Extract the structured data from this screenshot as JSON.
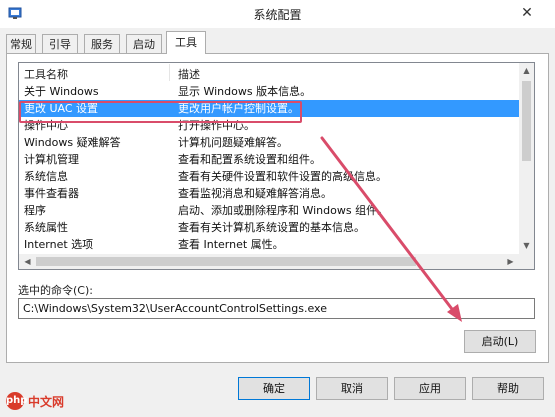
{
  "window": {
    "title": "系统配置",
    "app_icon": "system-config-icon",
    "close_glyph": "✕"
  },
  "tabs": [
    {
      "label": "常规",
      "active": false
    },
    {
      "label": "引导",
      "active": false
    },
    {
      "label": "服务",
      "active": false
    },
    {
      "label": "启动",
      "active": false
    },
    {
      "label": "工具",
      "active": true
    }
  ],
  "tools": {
    "columns": [
      "工具名称",
      "描述"
    ],
    "rows": [
      {
        "name": "关于 Windows",
        "desc": "显示 Windows 版本信息。"
      },
      {
        "name": "更改 UAC 设置",
        "desc": "更改用户帐户控制设置。"
      },
      {
        "name": "操作中心",
        "desc": "打开操作中心。"
      },
      {
        "name": "Windows 疑难解答",
        "desc": "计算机问题疑难解答。"
      },
      {
        "name": "计算机管理",
        "desc": "查看和配置系统设置和组件。"
      },
      {
        "name": "系统信息",
        "desc": "查看有关硬件设置和软件设置的高级信息。"
      },
      {
        "name": "事件查看器",
        "desc": "查看监视消息和疑难解答消息。"
      },
      {
        "name": "程序",
        "desc": "启动、添加或删除程序和 Windows 组件。"
      },
      {
        "name": "系统属性",
        "desc": "查看有关计算机系统设置的基本信息。"
      },
      {
        "name": "Internet 选项",
        "desc": "查看 Internet 属性。"
      }
    ],
    "selected_index": 1
  },
  "command": {
    "label": "选中的命令(C):",
    "value": "C:\\Windows\\System32\\UserAccountControlSettings.exe"
  },
  "buttons": {
    "launch": "启动(L)",
    "ok": "确定",
    "cancel": "取消",
    "apply": "应用",
    "help": "帮助"
  },
  "watermark": {
    "logo": "php",
    "text": "中文网"
  },
  "colors": {
    "selection": "#3399ff",
    "annotation": "#d94c6a"
  }
}
